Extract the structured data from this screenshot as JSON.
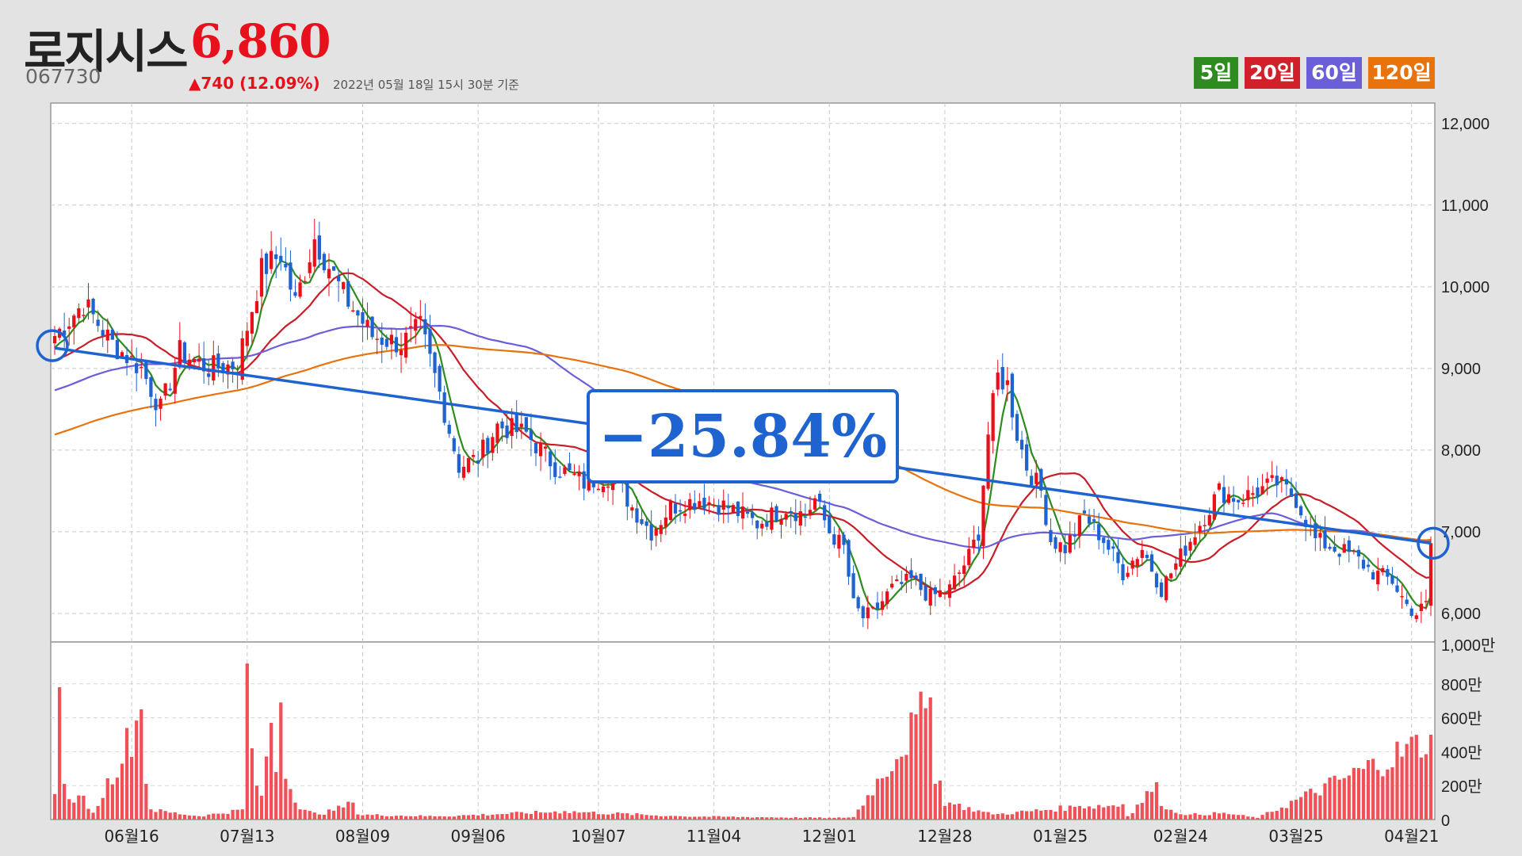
{
  "header": {
    "name": "로지시스",
    "price": "6,860",
    "code": "067730",
    "change": "▲740 (12.09%)",
    "as_of": "2022년 05월 18일 15시 30분 기준"
  },
  "legend": [
    {
      "label": "5일",
      "color": "#2e8b1f"
    },
    {
      "label": "20일",
      "color": "#d0202a"
    },
    {
      "label": "60일",
      "color": "#6a5fd8"
    },
    {
      "label": "120일",
      "color": "#e8720c"
    }
  ],
  "annotation": "−25.84%",
  "chart_data": {
    "type": "candlestick",
    "x_ticks": [
      "06월16",
      "07월13",
      "08월09",
      "09월06",
      "10월07",
      "11월04",
      "12월01",
      "12월28",
      "01월25",
      "02월24",
      "03월25",
      "04월21"
    ],
    "price_axis": {
      "ticks": [
        "12,000",
        "11,000",
        "10,000",
        "9,000",
        "8,000",
        "7,000",
        "6,000"
      ],
      "range": [
        5650,
        12250
      ]
    },
    "volume_axis": {
      "ticks": [
        "1,000만",
        "800만",
        "600만",
        "400만",
        "200만",
        "0"
      ],
      "range": [
        0,
        1000
      ]
    },
    "trend_line": {
      "start_price": 9250,
      "end_price": 6860,
      "change_pct": -25.84
    },
    "close_anchors": [
      [
        0,
        9400
      ],
      [
        6,
        9800
      ],
      [
        12,
        9300
      ],
      [
        18,
        9000
      ],
      [
        22,
        8500
      ],
      [
        26,
        9200
      ],
      [
        32,
        9000
      ],
      [
        38,
        9050
      ],
      [
        43,
        10200
      ],
      [
        47,
        10400
      ],
      [
        50,
        9800
      ],
      [
        54,
        10600
      ],
      [
        60,
        9900
      ],
      [
        66,
        9400
      ],
      [
        72,
        9300
      ],
      [
        76,
        9500
      ],
      [
        80,
        8700
      ],
      [
        84,
        7800
      ],
      [
        88,
        7900
      ],
      [
        92,
        8300
      ],
      [
        98,
        8200
      ],
      [
        104,
        7800
      ],
      [
        110,
        7600
      ],
      [
        116,
        7700
      ],
      [
        120,
        7300
      ],
      [
        124,
        7000
      ],
      [
        128,
        7300
      ],
      [
        134,
        7400
      ],
      [
        140,
        7300
      ],
      [
        146,
        7100
      ],
      [
        152,
        7300
      ],
      [
        156,
        7200
      ],
      [
        158,
        7400
      ],
      [
        161,
        7000
      ],
      [
        164,
        6800
      ],
      [
        166,
        6100
      ],
      [
        168,
        5950
      ],
      [
        170,
        6000
      ],
      [
        174,
        6300
      ],
      [
        178,
        6400
      ],
      [
        182,
        6200
      ],
      [
        186,
        6300
      ],
      [
        190,
        6700
      ],
      [
        192,
        7000
      ],
      [
        194,
        8200
      ],
      [
        196,
        8900
      ],
      [
        198,
        8800
      ],
      [
        200,
        8200
      ],
      [
        202,
        7800
      ],
      [
        205,
        7500
      ],
      [
        207,
        6900
      ],
      [
        210,
        6800
      ],
      [
        214,
        7200
      ],
      [
        218,
        6900
      ],
      [
        222,
        6500
      ],
      [
        226,
        6800
      ],
      [
        230,
        6300
      ],
      [
        234,
        6700
      ],
      [
        238,
        7100
      ],
      [
        242,
        7500
      ],
      [
        246,
        7400
      ],
      [
        250,
        7500
      ],
      [
        254,
        7600
      ],
      [
        258,
        7400
      ],
      [
        262,
        6900
      ],
      [
        266,
        6800
      ],
      [
        270,
        6700
      ],
      [
        274,
        6500
      ],
      [
        278,
        6400
      ],
      [
        281,
        6100
      ],
      [
        283,
        6000
      ],
      [
        285,
        6100
      ],
      [
        286,
        6860
      ]
    ],
    "volume_anchors": [
      [
        0,
        150
      ],
      [
        1,
        780
      ],
      [
        2,
        210
      ],
      [
        3,
        120
      ],
      [
        4,
        100
      ],
      [
        6,
        140
      ],
      [
        8,
        40
      ],
      [
        18,
        650
      ],
      [
        19,
        210
      ],
      [
        20,
        60
      ],
      [
        30,
        20
      ],
      [
        39,
        60
      ],
      [
        40,
        920
      ],
      [
        41,
        420
      ],
      [
        42,
        200
      ],
      [
        43,
        140
      ],
      [
        45,
        570
      ],
      [
        46,
        280
      ],
      [
        47,
        690
      ],
      [
        48,
        240
      ],
      [
        49,
        180
      ],
      [
        50,
        100
      ],
      [
        51,
        60
      ],
      [
        55,
        30
      ],
      [
        62,
        100
      ],
      [
        63,
        30
      ],
      [
        80,
        20
      ],
      [
        106,
        50
      ],
      [
        130,
        20
      ],
      [
        162,
        10
      ],
      [
        166,
        15
      ],
      [
        182,
        720
      ],
      [
        183,
        210
      ],
      [
        184,
        230
      ],
      [
        185,
        80
      ],
      [
        186,
        100
      ],
      [
        195,
        30
      ],
      [
        213,
        80
      ],
      [
        222,
        90
      ],
      [
        223,
        20
      ],
      [
        229,
        220
      ],
      [
        230,
        80
      ],
      [
        231,
        60
      ],
      [
        236,
        30
      ],
      [
        243,
        40
      ],
      [
        250,
        10
      ],
      [
        286,
        500
      ]
    ]
  }
}
